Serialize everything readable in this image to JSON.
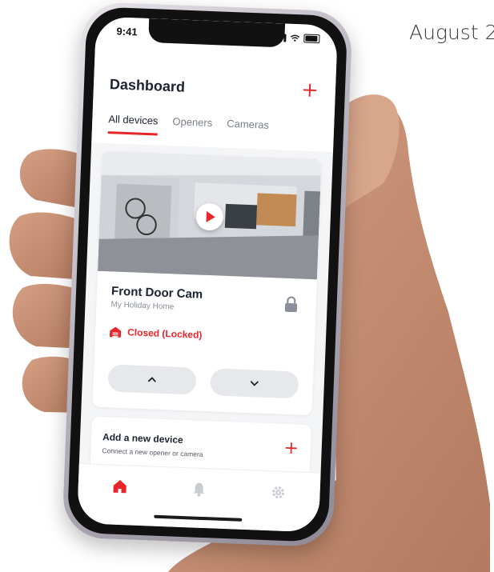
{
  "caption": {
    "date": "August 2"
  },
  "status_bar": {
    "time": "9:41"
  },
  "header": {
    "title": "Dashboard",
    "add_icon": "plus-icon",
    "tabs": [
      {
        "label": "All devices",
        "active": true
      },
      {
        "label": "Openers",
        "active": false
      },
      {
        "label": "Cameras",
        "active": false
      }
    ]
  },
  "device_card": {
    "name": "Front Door Cam",
    "location": "My Holiday Home",
    "status": "Closed (Locked)",
    "status_icon": "garage-icon",
    "lock_icon": "lock-icon",
    "controls": {
      "up_icon": "chevron-up-icon",
      "down_icon": "chevron-down-icon"
    }
  },
  "add_device": {
    "title": "Add a new device",
    "subtitle": "Connect a new opener or camera"
  },
  "bottom_nav": {
    "items": [
      "home-icon",
      "bell-icon",
      "gear-icon"
    ],
    "active": "home-icon"
  },
  "colors": {
    "accent": "#e8262a",
    "text_dark": "#1b2230",
    "muted": "#8a8f99"
  }
}
